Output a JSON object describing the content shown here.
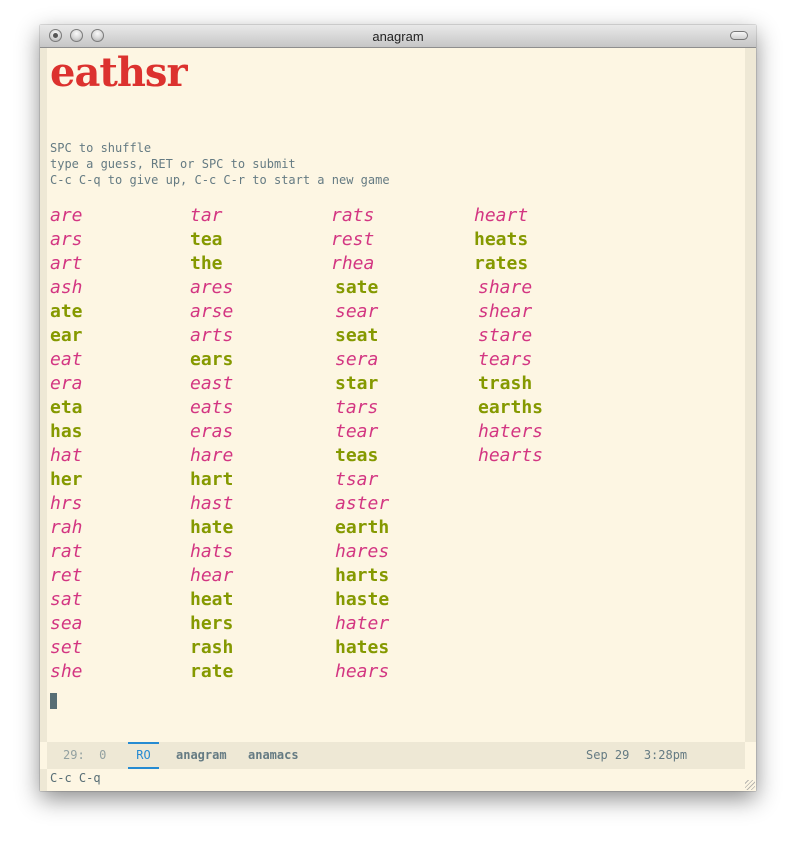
{
  "window": {
    "title": "anagram"
  },
  "game": {
    "letters": "eathsr",
    "help": [
      "SPC to shuffle",
      "type a guess, RET or SPC to submit",
      "C-c C-q to give up, C-c C-r to start a new game"
    ],
    "colors": {
      "title": "#dc322f",
      "found": "#859900",
      "missing": "#d33682"
    },
    "columns": [
      [
        {
          "word": "are",
          "found": false
        },
        {
          "word": "ars",
          "found": false
        },
        {
          "word": "art",
          "found": false
        },
        {
          "word": "ash",
          "found": false
        },
        {
          "word": "ate",
          "found": true
        },
        {
          "word": "ear",
          "found": true
        },
        {
          "word": "eat",
          "found": false
        },
        {
          "word": "era",
          "found": false
        },
        {
          "word": "eta",
          "found": true
        },
        {
          "word": "has",
          "found": true
        },
        {
          "word": "hat",
          "found": false
        },
        {
          "word": "her",
          "found": true
        },
        {
          "word": "hrs",
          "found": false
        },
        {
          "word": "rah",
          "found": false
        },
        {
          "word": "rat",
          "found": false
        },
        {
          "word": "ret",
          "found": false
        },
        {
          "word": "sat",
          "found": false
        },
        {
          "word": "sea",
          "found": false
        },
        {
          "word": "set",
          "found": false
        },
        {
          "word": "she",
          "found": false
        }
      ],
      [
        {
          "word": "tar",
          "found": false
        },
        {
          "word": "tea",
          "found": true
        },
        {
          "word": "the",
          "found": true
        },
        {
          "word": "ares",
          "found": false
        },
        {
          "word": "arse",
          "found": false
        },
        {
          "word": "arts",
          "found": false
        },
        {
          "word": "ears",
          "found": true
        },
        {
          "word": "east",
          "found": false
        },
        {
          "word": "eats",
          "found": false
        },
        {
          "word": "eras",
          "found": false
        },
        {
          "word": "hare",
          "found": false
        },
        {
          "word": "hart",
          "found": true
        },
        {
          "word": "hast",
          "found": false
        },
        {
          "word": "hate",
          "found": true
        },
        {
          "word": "hats",
          "found": false
        },
        {
          "word": "hear",
          "found": false
        },
        {
          "word": "heat",
          "found": true
        },
        {
          "word": "hers",
          "found": true
        },
        {
          "word": "rash",
          "found": true
        },
        {
          "word": "rate",
          "found": true
        }
      ],
      [
        {
          "word": "rats",
          "found": false
        },
        {
          "word": "rest",
          "found": false
        },
        {
          "word": "rhea",
          "found": false
        },
        {
          "word": "sate",
          "found": true
        },
        {
          "word": "sear",
          "found": false
        },
        {
          "word": "seat",
          "found": true
        },
        {
          "word": "sera",
          "found": false
        },
        {
          "word": "star",
          "found": true
        },
        {
          "word": "tars",
          "found": false
        },
        {
          "word": "tear",
          "found": false
        },
        {
          "word": "teas",
          "found": true
        },
        {
          "word": "tsar",
          "found": false
        },
        {
          "word": "aster",
          "found": false
        },
        {
          "word": "earth",
          "found": true
        },
        {
          "word": "hares",
          "found": false
        },
        {
          "word": "harts",
          "found": true
        },
        {
          "word": "haste",
          "found": true
        },
        {
          "word": "hater",
          "found": false
        },
        {
          "word": "hates",
          "found": true
        },
        {
          "word": "hears",
          "found": false
        }
      ],
      [
        {
          "word": "heart",
          "found": false
        },
        {
          "word": "heats",
          "found": true
        },
        {
          "word": "rates",
          "found": true
        },
        {
          "word": "share",
          "found": false
        },
        {
          "word": "shear",
          "found": false
        },
        {
          "word": "stare",
          "found": false
        },
        {
          "word": "tears",
          "found": false
        },
        {
          "word": "trash",
          "found": true
        },
        {
          "word": "earths",
          "found": true
        },
        {
          "word": "haters",
          "found": false
        },
        {
          "word": "hearts",
          "found": false
        }
      ]
    ]
  },
  "modeline": {
    "position": "29:  0",
    "read_only": "RO",
    "buffer_name": "anagram",
    "mode_name": "anamacs",
    "date": "Sep 29",
    "time": "3:28pm"
  },
  "echo_area": {
    "text": "C-c C-q"
  }
}
